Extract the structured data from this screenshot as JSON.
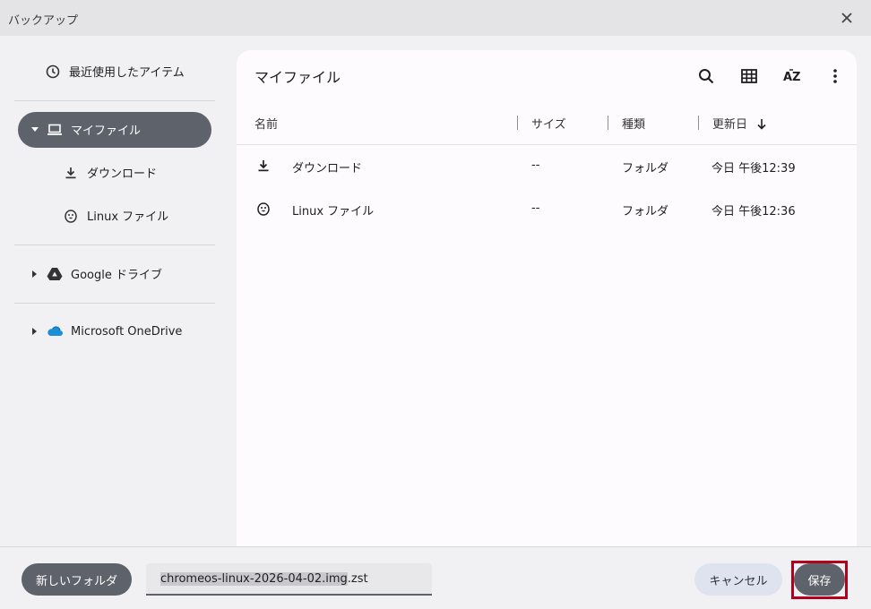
{
  "window": {
    "title": "バックアップ"
  },
  "sidebar": {
    "recent": "最近使用したアイテム",
    "my_files": "マイファイル",
    "downloads": "ダウンロード",
    "linux_files": "Linux ファイル",
    "google_drive": "Google ドライブ",
    "onedrive": "Microsoft OneDrive"
  },
  "main": {
    "title": "マイファイル",
    "columns": {
      "name": "名前",
      "size": "サイズ",
      "type": "種類",
      "modified": "更新日"
    },
    "rows": [
      {
        "name": "ダウンロード",
        "size": "--",
        "type": "フォルダ",
        "modified": "今日 午後12:39",
        "icon": "download-icon"
      },
      {
        "name": "Linux ファイル",
        "size": "--",
        "type": "フォルダ",
        "modified": "今日 午後12:36",
        "icon": "penguin-icon"
      }
    ]
  },
  "footer": {
    "new_folder": "新しいフォルダ",
    "filename_selected": "chromeos-linux-2026-04-02.img",
    "filename_ext": ".zst",
    "cancel": "キャンセル",
    "save": "保存"
  },
  "colors": {
    "accent": "#5e626b",
    "highlight": "#b3001b"
  }
}
